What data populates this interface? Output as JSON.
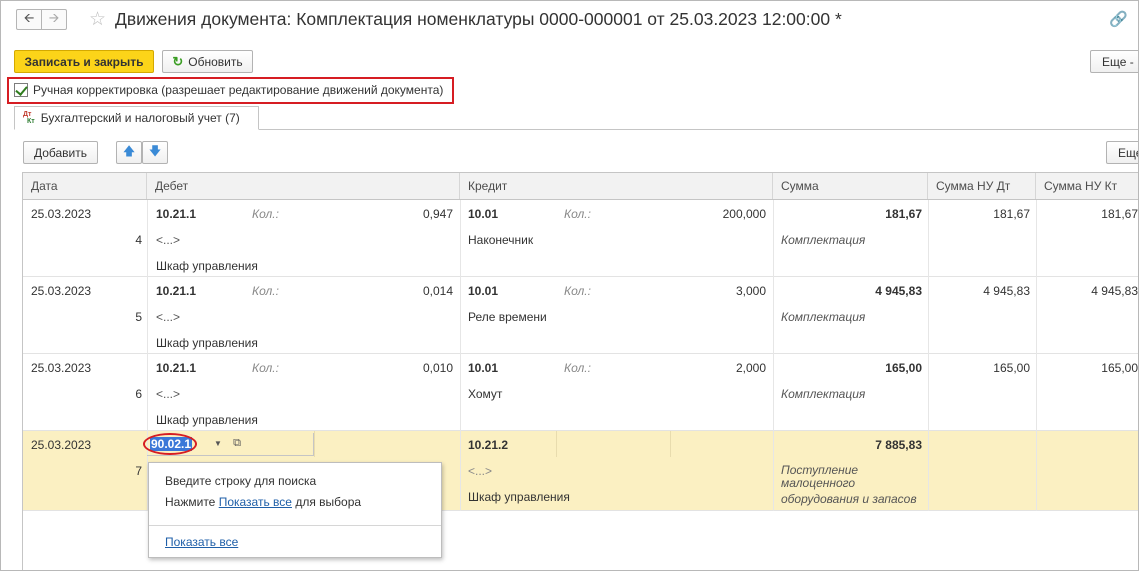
{
  "window": {
    "title": "Движения документа: Комплектация номенклатуры 0000-000001 от 25.03.2023 12:00:00 *"
  },
  "toolbar": {
    "save_close_label": "Записать и закрыть",
    "refresh_label": "Обновить",
    "more_label": "Еще -"
  },
  "manual_correction": {
    "label": "Ручная корректировка (разрешает редактирование движений документа)",
    "checked": true
  },
  "tabs": [
    {
      "label": "Бухгалтерский и налоговый учет (7)",
      "icon_top": "Дт",
      "icon_bottom": "Кт"
    }
  ],
  "table_toolbar": {
    "add_label": "Добавить",
    "more_label": "Еще"
  },
  "table": {
    "columns": [
      "Дата",
      "Дебет",
      "Кредит",
      "Сумма",
      "Сумма НУ Дт",
      "Сумма НУ Кт"
    ],
    "qty_label": "Кол.:",
    "rows": [
      {
        "date": "25.03.2023",
        "num": "4",
        "debit_account": "10.21.1",
        "debit_qty": "0,947",
        "debit_sub1": "<...>",
        "debit_sub2": "Шкаф управления",
        "credit_account": "10.01",
        "credit_qty": "200,000",
        "credit_sub1": "Наконечник",
        "sum": "181,67",
        "sum_note": "Комплектация",
        "sum_nu_dt": "181,67",
        "sum_nu_kt": "181,67"
      },
      {
        "date": "25.03.2023",
        "num": "5",
        "debit_account": "10.21.1",
        "debit_qty": "0,014",
        "debit_sub1": "<...>",
        "debit_sub2": "Шкаф управления",
        "credit_account": "10.01",
        "credit_qty": "3,000",
        "credit_sub1": "Реле времени",
        "sum": "4 945,83",
        "sum_note": "Комплектация",
        "sum_nu_dt": "4 945,83",
        "sum_nu_kt": "4 945,83"
      },
      {
        "date": "25.03.2023",
        "num": "6",
        "debit_account": "10.21.1",
        "debit_qty": "0,010",
        "debit_sub1": "<...>",
        "debit_sub2": "Шкаф управления",
        "credit_account": "10.01",
        "credit_qty": "2,000",
        "credit_sub1": "Хомут",
        "sum": "165,00",
        "sum_note": "Комплектация",
        "sum_nu_dt": "165,00",
        "sum_nu_kt": "165,00"
      },
      {
        "date": "25.03.2023",
        "num": "7",
        "debit_account": "90.02.1",
        "credit_account": "10.21.2",
        "credit_sub1": "<...>",
        "credit_sub2": "Шкаф управления",
        "sum": "7 885,83",
        "sum_note_1": "Поступление",
        "sum_note_2": "малоценного",
        "sum_note_3": "оборудования и запасов"
      }
    ]
  },
  "popup": {
    "line1": "Введите строку для поиска",
    "line2_prefix": "Нажмите",
    "line2_link": "Показать все",
    "line2_suffix": "для выбора",
    "show_all": "Показать все"
  }
}
